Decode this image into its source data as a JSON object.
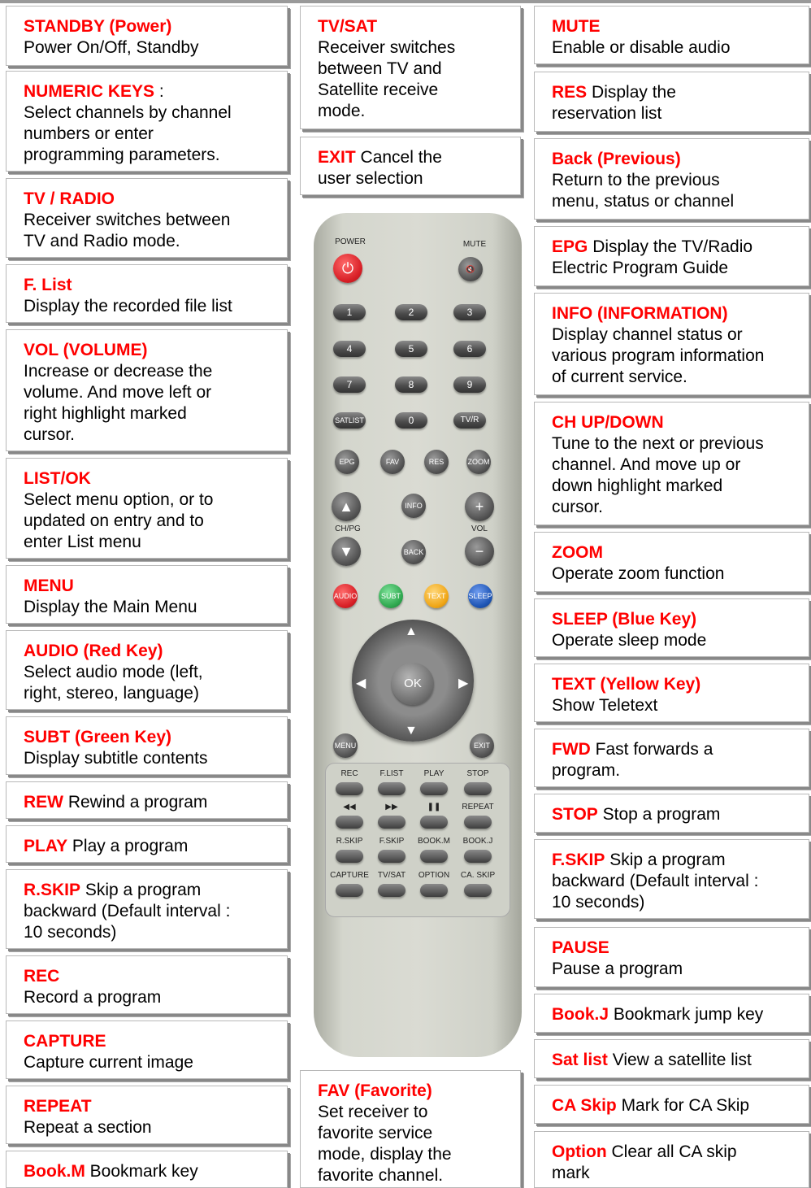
{
  "left_column": [
    {
      "title": "STANDBY (Power)",
      "text": "Power On/Off, Standby"
    },
    {
      "title": "NUMERIC KEYS",
      "title_suffix": " :",
      "text": "Select channels by channel\nnumbers or enter\nprogramming parameters."
    },
    {
      "title": "TV / RADIO",
      "text": "Receiver switches between\nTV and Radio mode."
    },
    {
      "title": "F. List",
      "text": "Display the recorded file list"
    },
    {
      "title": "VOL (VOLUME)",
      "text": "Increase or decrease the\nvolume. And move left or\nright highlight marked\ncursor."
    },
    {
      "title": "LIST/OK",
      "text": "Select menu option, or to\nupdated on entry and to\nenter List menu"
    },
    {
      "title": "MENU",
      "text": "Display the Main Menu"
    },
    {
      "title": "AUDIO (Red Key)",
      "text": "Select audio mode (left,\nright, stereo, language)"
    },
    {
      "title": "SUBT (Green Key)",
      "text": "Display subtitle contents"
    },
    {
      "title": "REW",
      "text": " Rewind a program"
    },
    {
      "title": "PLAY",
      "text": " Play a program"
    },
    {
      "title": "R.SKIP",
      "text": " Skip a program\nbackward (Default interval :\n10 seconds)"
    },
    {
      "title": "REC",
      "text": "Record a program"
    },
    {
      "title": "CAPTURE",
      "text": "Capture current image"
    },
    {
      "title": "REPEAT",
      "text": "Repeat a section"
    },
    {
      "title": "Book.M",
      "text": " Bookmark key"
    }
  ],
  "middle_column": [
    {
      "title": "TV/SAT",
      "text": "Receiver switches\nbetween TV and\nSatellite receive\nmode."
    },
    {
      "title": "EXIT",
      "text": "   Cancel the\nuser selection"
    },
    {
      "title": "FAV (Favorite)",
      "text": "Set receiver to\nfavorite service\nmode, display the\nfavorite channel."
    }
  ],
  "right_column": [
    {
      "title": "MUTE",
      "text": "Enable or disable audio"
    },
    {
      "title": "RES",
      "text": "  Display the\nreservation list"
    },
    {
      "title": "Back (Previous)",
      "text": "Return to the previous\nmenu, status or channel"
    },
    {
      "title": "EPG",
      "text": "  Display the TV/Radio\nElectric Program Guide"
    },
    {
      "title": "INFO  (INFORMATION)",
      "text": "Display channel status or\nvarious program information\nof current service."
    },
    {
      "title": "CH UP/DOWN",
      "text": "Tune to the next or previous\nchannel. And move up or\ndown highlight marked\ncursor."
    },
    {
      "title": "ZOOM",
      "text": "Operate zoom function"
    },
    {
      "title": "SLEEP (Blue Key)",
      "text": "Operate sleep mode"
    },
    {
      "title": "TEXT (Yellow Key)",
      "text": "Show Teletext"
    },
    {
      "title": "FWD",
      "text": " Fast forwards a\nprogram."
    },
    {
      "title": "STOP",
      "text": " Stop a program"
    },
    {
      "title": "F.SKIP",
      "text": " Skip a program\nbackward (Default interval :\n10 seconds)"
    },
    {
      "title": "PAUSE",
      "text": "Pause a program"
    },
    {
      "title": "Book.J",
      "text": " Bookmark jump key"
    },
    {
      "title": "Sat list",
      "text": " View a satellite list"
    },
    {
      "title": "CA Skip",
      "text": "   Mark for CA Skip"
    },
    {
      "title": "Option",
      "text": "     Clear all CA skip\nmark"
    }
  ],
  "remote": {
    "power_label": "POWER",
    "mute_label": "MUTE",
    "num_keys": [
      "1",
      "2",
      "3",
      "4",
      "5",
      "6",
      "7",
      "8",
      "9"
    ],
    "satlist": "SATLIST",
    "zero": "0",
    "tvr": "TV/R",
    "func_keys": [
      "EPG",
      "FAV",
      "RES",
      "ZOOM"
    ],
    "info": "INFO",
    "back": "BACK",
    "chpg": "CH/PG",
    "vol": "VOL",
    "plus": "+",
    "minus": "−",
    "up": "▲",
    "down": "▼",
    "color_keys": [
      "AUDIO",
      "SUBT",
      "TEXT",
      "SLEEP"
    ],
    "ok": "OK",
    "menu": "MENU",
    "exit": "EXIT",
    "nav_up": "▲",
    "nav_down": "▼",
    "nav_left": "◀",
    "nav_right": "▶",
    "row1": [
      "REC",
      "F.LIST",
      "PLAY",
      "STOP"
    ],
    "row2": [
      "◀◀",
      "▶▶",
      "❚❚",
      "REPEAT"
    ],
    "row3": [
      "R.SKIP",
      "F.SKIP",
      "BOOK.M",
      "BOOK.J"
    ],
    "row4": [
      "CAPTURE",
      "TV/SAT",
      "OPTION",
      "CA. SKIP"
    ],
    "colors": {
      "power": "#e0262a",
      "audio": "#d81f26",
      "subt": "#2fa84f",
      "text": "#f0a616",
      "sleep": "#1e55b4"
    }
  }
}
